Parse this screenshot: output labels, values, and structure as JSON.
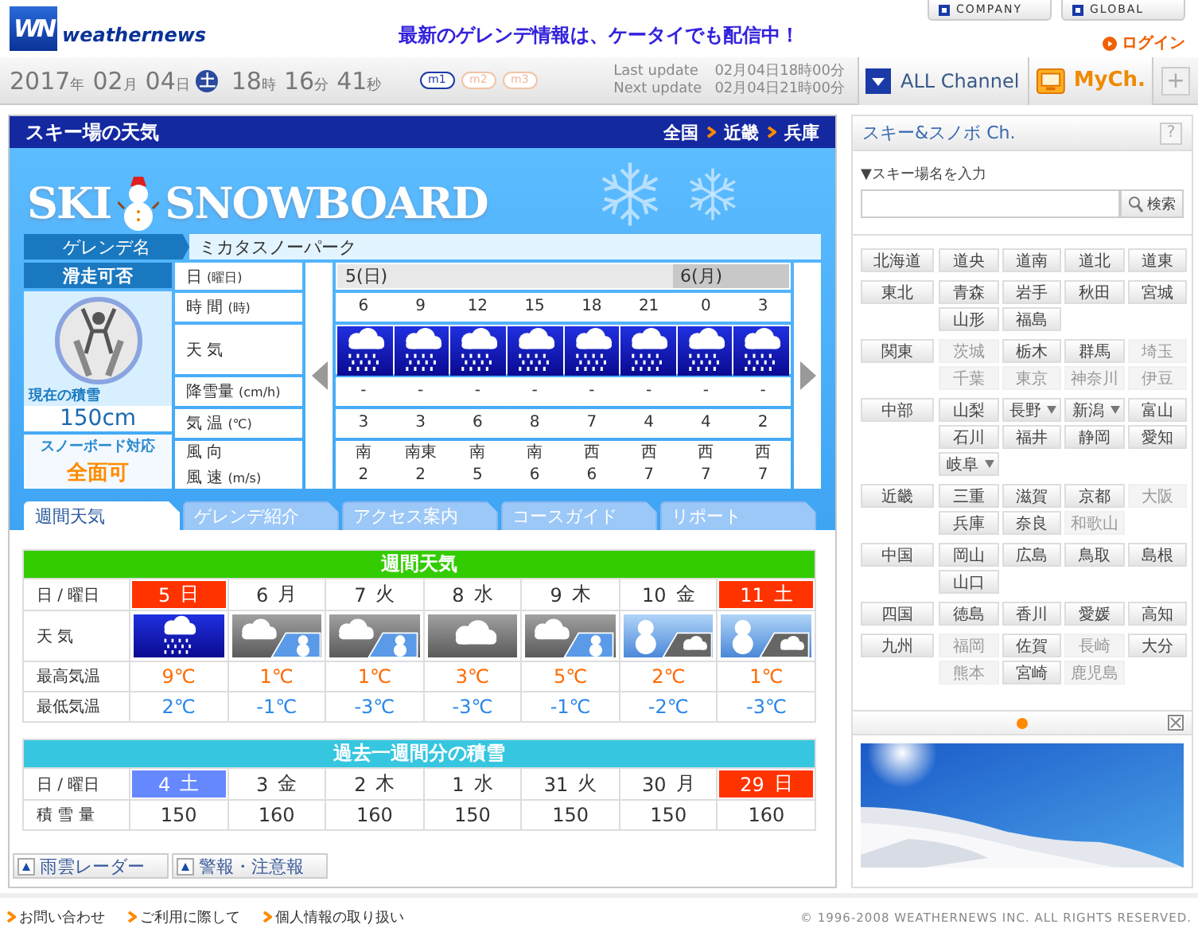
{
  "header": {
    "logo_mark": "WN",
    "logo_text": "weathernews",
    "promo": "最新のゲレンデ情報は、ケータイでも配信中！",
    "links": [
      "COMPANY",
      "GLOBAL"
    ],
    "login": "ログイン"
  },
  "clock": {
    "date_parts": [
      {
        "value": "2017",
        "unit": "年"
      },
      {
        "value": "02",
        "unit": "月"
      },
      {
        "value": "04",
        "unit": "日"
      }
    ],
    "weekday": "土",
    "time_parts": [
      {
        "value": "18",
        "unit": "時"
      },
      {
        "value": "16",
        "unit": "分"
      },
      {
        "value": "41",
        "unit": "秒"
      }
    ]
  },
  "modes": [
    {
      "label": "m1",
      "selected": true
    },
    {
      "label": "m2",
      "selected": false
    },
    {
      "label": "m3",
      "selected": false
    }
  ],
  "updates": [
    {
      "label": "Last update",
      "value": "02月04日18時00分"
    },
    {
      "label": "Next update",
      "value": "02月04日21時00分"
    }
  ],
  "channels": {
    "all": "ALL Channel",
    "my": "MyCh.",
    "add": "+"
  },
  "resort_panel": {
    "title": "スキー場の天気",
    "breadcrumb": [
      "全国",
      "近畿",
      "兵庫"
    ],
    "logo": [
      "SKI",
      "SNOWBOARD"
    ],
    "name_label": "ゲレンデ名",
    "name": "ミカタスノーパーク",
    "status": {
      "title": "滑走可否",
      "snow_label": "現在の積雪",
      "snow_depth": "150cm",
      "board_label": "スノーボード対応",
      "board_value": "全面可"
    },
    "row_labels": [
      {
        "lines": [
          {
            "text": "日",
            "unit": "(曜日)"
          }
        ]
      },
      {
        "lines": [
          {
            "text": "時 間",
            "unit": "(時)"
          }
        ]
      },
      {
        "lines": [
          {
            "text": "天 気"
          }
        ]
      },
      {
        "lines": [
          {
            "text": "降雪量",
            "unit": "(cm/h)"
          }
        ]
      },
      {
        "lines": [
          {
            "text": "気 温",
            "unit": "(℃)"
          }
        ]
      },
      {
        "lines": [
          {
            "text": "風 向"
          },
          {
            "text": "風 速",
            "unit": "(m/s)"
          }
        ]
      }
    ],
    "days": [
      {
        "label": "5(日)",
        "hours": [
          {
            "time": "6",
            "kind": "rain",
            "snowfall": "-",
            "temp": "3",
            "wind_dir": "南",
            "wind_speed": "2"
          },
          {
            "time": "9",
            "kind": "rain",
            "snowfall": "-",
            "temp": "3",
            "wind_dir": "南東",
            "wind_speed": "2"
          },
          {
            "time": "12",
            "kind": "rain",
            "snowfall": "-",
            "temp": "6",
            "wind_dir": "南",
            "wind_speed": "5"
          },
          {
            "time": "15",
            "kind": "rain",
            "snowfall": "-",
            "temp": "8",
            "wind_dir": "南",
            "wind_speed": "6"
          },
          {
            "time": "18",
            "kind": "rain",
            "snowfall": "-",
            "temp": "7",
            "wind_dir": "西",
            "wind_speed": "6"
          },
          {
            "time": "21",
            "kind": "rain",
            "snowfall": "-",
            "temp": "4",
            "wind_dir": "西",
            "wind_speed": "7"
          }
        ]
      },
      {
        "label": "6(月)",
        "hours": [
          {
            "time": "0",
            "kind": "rain",
            "snowfall": "-",
            "temp": "4",
            "wind_dir": "西",
            "wind_speed": "7"
          },
          {
            "time": "3",
            "kind": "rain",
            "snowfall": "-",
            "temp": "2",
            "wind_dir": "西",
            "wind_speed": "7"
          }
        ]
      }
    ]
  },
  "tabs": [
    {
      "label": "週間天気",
      "selected": true
    },
    {
      "label": "ゲレンデ紹介",
      "selected": false
    },
    {
      "label": "アクセス案内",
      "selected": false
    },
    {
      "label": "コースガイド",
      "selected": false
    },
    {
      "label": "リポート",
      "selected": false
    }
  ],
  "weekly": {
    "title": "週間天気",
    "labels": [
      "日 / 曜日",
      "天 気",
      "最高気温",
      "最低気温"
    ],
    "days": [
      {
        "date": "5",
        "weekday": "日",
        "color": "#ff3300",
        "kind": "rain",
        "high": "9℃",
        "low": "2℃"
      },
      {
        "date": "6",
        "weekday": "月",
        "color": "#ffffff",
        "kind": "cloudy_snow",
        "high": "1℃",
        "low": "-1℃"
      },
      {
        "date": "7",
        "weekday": "火",
        "color": "#ffffff",
        "kind": "cloudy_snow",
        "high": "1℃",
        "low": "-3℃"
      },
      {
        "date": "8",
        "weekday": "水",
        "color": "#ffffff",
        "kind": "cloudy",
        "high": "3℃",
        "low": "-3℃"
      },
      {
        "date": "9",
        "weekday": "木",
        "color": "#ffffff",
        "kind": "cloudy_snow",
        "high": "5℃",
        "low": "-1℃"
      },
      {
        "date": "10",
        "weekday": "金",
        "color": "#ffffff",
        "kind": "snow_cloudy",
        "high": "2℃",
        "low": "-2℃"
      },
      {
        "date": "11",
        "weekday": "土",
        "color": "#ff3300",
        "kind": "snow_cloudy",
        "high": "1℃",
        "low": "-3℃"
      }
    ]
  },
  "past_snow": {
    "title": "過去一週間分の積雪",
    "labels": [
      "日 / 曜日",
      "積 雪 量"
    ],
    "days": [
      {
        "date": "4",
        "weekday": "土",
        "color": "#6688ff",
        "depth": "150"
      },
      {
        "date": "3",
        "weekday": "金",
        "color": "#ffffff",
        "depth": "160"
      },
      {
        "date": "2",
        "weekday": "木",
        "color": "#ffffff",
        "depth": "160"
      },
      {
        "date": "1",
        "weekday": "水",
        "color": "#ffffff",
        "depth": "150"
      },
      {
        "date": "31",
        "weekday": "火",
        "color": "#ffffff",
        "depth": "150"
      },
      {
        "date": "30",
        "weekday": "月",
        "color": "#ffffff",
        "depth": "150"
      },
      {
        "date": "29",
        "weekday": "日",
        "color": "#ff3300",
        "depth": "160"
      }
    ]
  },
  "quick_links": [
    "雨雲レーダー",
    "警報・注意報"
  ],
  "sidebar": {
    "title": "スキー&スノボ Ch.",
    "help": "?",
    "search_label": "▼スキー場名を入力",
    "search_button": "検索",
    "regions": [
      {
        "name": "北海道",
        "prefectures": [
          {
            "name": "道央",
            "disabled": false,
            "dropdown": false
          },
          {
            "name": "道南",
            "disabled": false,
            "dropdown": false
          },
          {
            "name": "道北",
            "disabled": false,
            "dropdown": false
          },
          {
            "name": "道東",
            "disabled": false,
            "dropdown": false
          }
        ]
      },
      {
        "name": "東北",
        "prefectures": [
          {
            "name": "青森",
            "disabled": false,
            "dropdown": false
          },
          {
            "name": "岩手",
            "disabled": false,
            "dropdown": false
          },
          {
            "name": "秋田",
            "disabled": false,
            "dropdown": false
          },
          {
            "name": "宮城",
            "disabled": false,
            "dropdown": false
          },
          {
            "name": "山形",
            "disabled": false,
            "dropdown": false
          },
          {
            "name": "福島",
            "disabled": false,
            "dropdown": false
          }
        ]
      },
      {
        "name": "関東",
        "prefectures": [
          {
            "name": "茨城",
            "disabled": true,
            "dropdown": false
          },
          {
            "name": "栃木",
            "disabled": false,
            "dropdown": false
          },
          {
            "name": "群馬",
            "disabled": false,
            "dropdown": false
          },
          {
            "name": "埼玉",
            "disabled": true,
            "dropdown": false
          },
          {
            "name": "千葉",
            "disabled": true,
            "dropdown": false
          },
          {
            "name": "東京",
            "disabled": true,
            "dropdown": false
          },
          {
            "name": "神奈川",
            "disabled": true,
            "dropdown": false
          },
          {
            "name": "伊豆",
            "disabled": true,
            "dropdown": false
          }
        ]
      },
      {
        "name": "中部",
        "prefectures": [
          {
            "name": "山梨",
            "disabled": false,
            "dropdown": false
          },
          {
            "name": "長野",
            "disabled": false,
            "dropdown": true
          },
          {
            "name": "新潟",
            "disabled": false,
            "dropdown": true
          },
          {
            "name": "富山",
            "disabled": false,
            "dropdown": false
          },
          {
            "name": "石川",
            "disabled": false,
            "dropdown": false
          },
          {
            "name": "福井",
            "disabled": false,
            "dropdown": false
          },
          {
            "name": "静岡",
            "disabled": false,
            "dropdown": false
          },
          {
            "name": "愛知",
            "disabled": false,
            "dropdown": false
          },
          {
            "name": "岐阜",
            "disabled": false,
            "dropdown": true
          }
        ]
      },
      {
        "name": "近畿",
        "prefectures": [
          {
            "name": "三重",
            "disabled": false,
            "dropdown": false
          },
          {
            "name": "滋賀",
            "disabled": false,
            "dropdown": false
          },
          {
            "name": "京都",
            "disabled": false,
            "dropdown": false
          },
          {
            "name": "大阪",
            "disabled": true,
            "dropdown": false
          },
          {
            "name": "兵庫",
            "disabled": false,
            "dropdown": false
          },
          {
            "name": "奈良",
            "disabled": false,
            "dropdown": false
          },
          {
            "name": "和歌山",
            "disabled": true,
            "dropdown": false
          }
        ]
      },
      {
        "name": "中国",
        "prefectures": [
          {
            "name": "岡山",
            "disabled": false,
            "dropdown": false
          },
          {
            "name": "広島",
            "disabled": false,
            "dropdown": false
          },
          {
            "name": "鳥取",
            "disabled": false,
            "dropdown": false
          },
          {
            "name": "島根",
            "disabled": false,
            "dropdown": false
          },
          {
            "name": "山口",
            "disabled": false,
            "dropdown": false
          }
        ]
      },
      {
        "name": "四国",
        "prefectures": [
          {
            "name": "徳島",
            "disabled": false,
            "dropdown": false
          },
          {
            "name": "香川",
            "disabled": false,
            "dropdown": false
          },
          {
            "name": "愛媛",
            "disabled": false,
            "dropdown": false
          },
          {
            "name": "高知",
            "disabled": false,
            "dropdown": false
          }
        ]
      },
      {
        "name": "九州",
        "prefectures": [
          {
            "name": "福岡",
            "disabled": true,
            "dropdown": false
          },
          {
            "name": "佐賀",
            "disabled": false,
            "dropdown": false
          },
          {
            "name": "長崎",
            "disabled": true,
            "dropdown": false
          },
          {
            "name": "大分",
            "disabled": false,
            "dropdown": false
          },
          {
            "name": "熊本",
            "disabled": true,
            "dropdown": false
          },
          {
            "name": "宮崎",
            "disabled": false,
            "dropdown": false
          },
          {
            "name": "鹿児島",
            "disabled": true,
            "dropdown": false
          }
        ]
      }
    ]
  },
  "footer": {
    "links": [
      "お問い合わせ",
      "ご利用に際して",
      "個人情報の取り扱い"
    ],
    "copyright": "© 1996-2008 WEATHERNEWS INC. ALL RIGHTS RESERVED."
  }
}
